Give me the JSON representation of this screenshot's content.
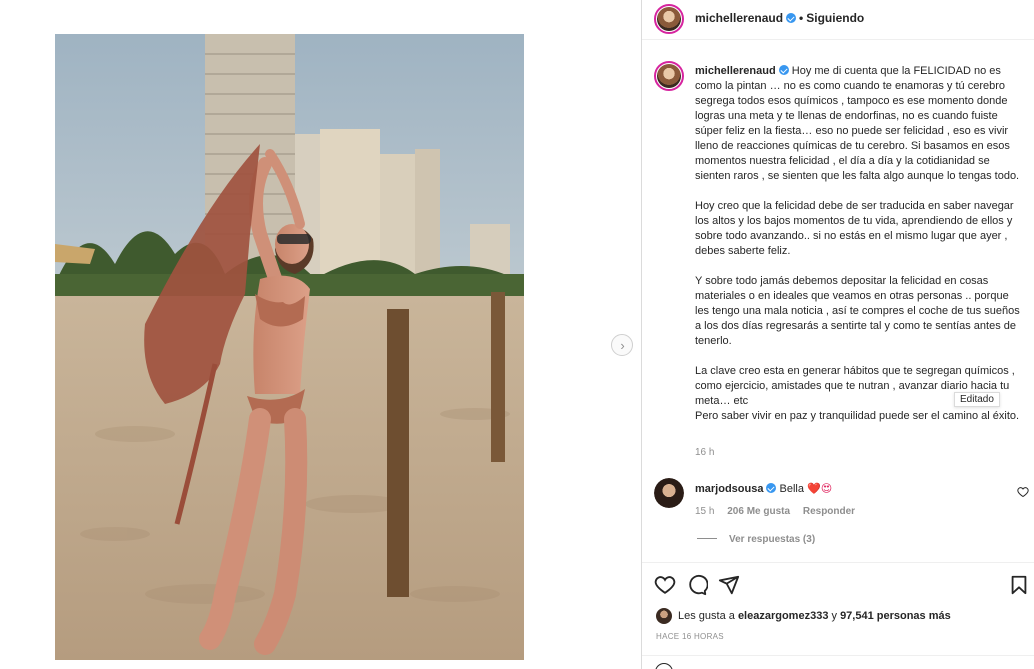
{
  "post": {
    "username": "michellerenaud",
    "follow_status": "Siguiendo",
    "separator": "•",
    "caption": "Hoy me di cuenta que la FELICIDAD no es como la pintan … no es como cuando te enamoras y tú cerebro segrega todos esos químicos , tampoco es ese momento donde logras una meta y te llenas de endorfinas, no es cuando fuiste súper feliz en la fiesta… eso no puede ser felicidad , eso es vivir lleno de reacciones químicas de tu cerebro. Si basamos en esos momentos nuestra felicidad , el día a día y la cotidianidad se sienten raros , se sienten que les falta algo aunque lo tengas todo.\n\nHoy creo que la felicidad debe de ser traducida en saber navegar los altos y los bajos momentos de tu vida, aprendiendo de ellos y sobre todo avanzando.. si no estás en el mismo lugar que ayer , debes saberte feliz.\n\nY sobre todo jamás debemos depositar la felicidad en cosas materiales o en ideales que veamos en otras personas .. porque les tengo una mala noticia , así te compres el coche de tus sueños a los dos días regresarás a sentirte tal y como te sentías antes de tenerlo.\n\nLa clave creo esta en generar hábitos que te segregan químicos , como ejercicio, amistades que te nutran , avanzar diario hacia tu meta… etc\nPero saber vivir en paz y tranquilidad puede ser el camino al éxito.",
    "caption_time": "16 h",
    "edited_tooltip": "Editado"
  },
  "comment": {
    "username": "marjodsousa",
    "text": "Bella",
    "emojis": "❤️😍",
    "time": "15 h",
    "likes": "206 Me gusta",
    "reply_label": "Responder",
    "view_replies": "Ver respuestas (3)"
  },
  "likes": {
    "prefix": "Les gusta a",
    "user": "eleazargomez333",
    "connector": "y",
    "count_text": "97,541 personas más"
  },
  "time_ago": "HACE 16 HORAS",
  "icons": {
    "like": "heart-icon",
    "comment": "comment-icon",
    "share": "share-icon",
    "save": "bookmark-icon",
    "next": "chevron-right-icon"
  },
  "colors": {
    "verified": "#3897f0",
    "muted": "#8e8e8e",
    "text": "#262626",
    "heart": "#e0245e"
  }
}
